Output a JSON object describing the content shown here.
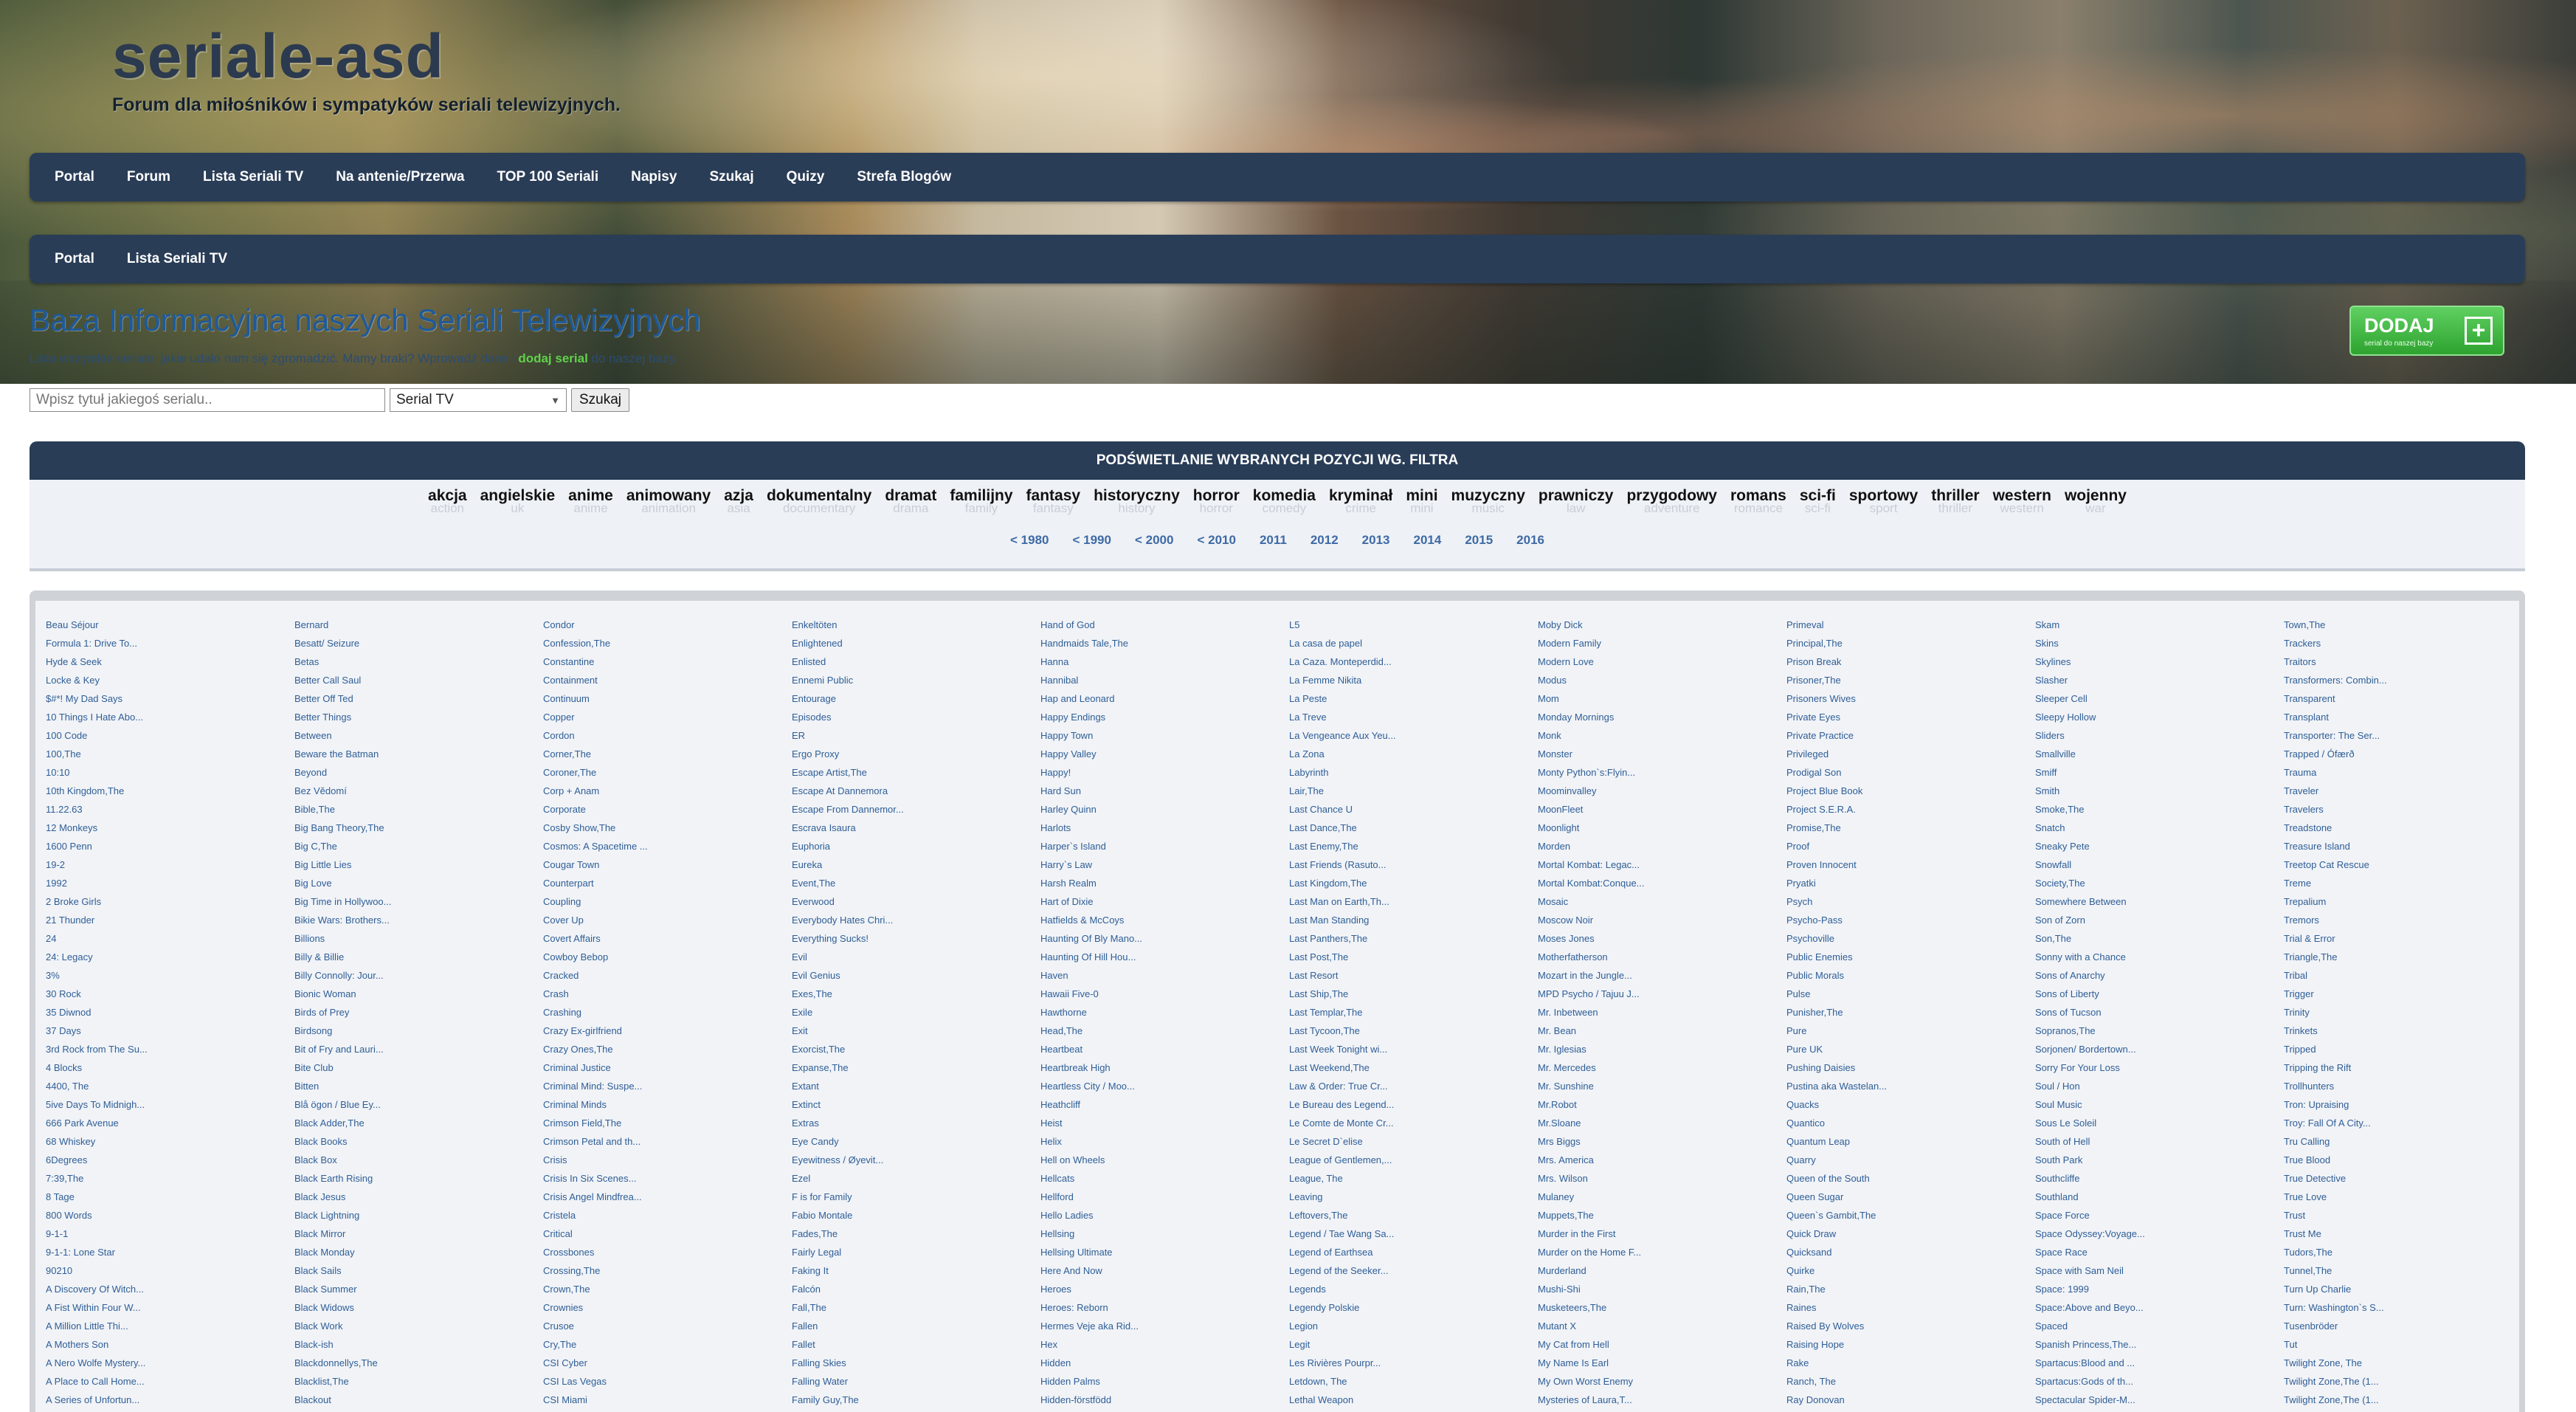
{
  "site": {
    "title": "seriale-asd",
    "subtitle": "Forum dla miłośników i sympatyków seriali telewizyjnych."
  },
  "nav_main": [
    "Portal",
    "Forum",
    "Lista Seriali TV",
    "Na antenie/Przerwa",
    "TOP 100 Seriali",
    "Napisy",
    "Szukaj",
    "Quizy",
    "Strefa Blogów"
  ],
  "nav_crumb": [
    "Portal",
    "Lista Seriali TV"
  ],
  "info": {
    "title": "Baza Informacyjna naszych Seriali Telewizyjnych",
    "text_before": "Lista wszystkie seriale, jakie udało nam się zgromadzić. Mamy braki? Wprowadź dane i ",
    "link": "dodaj serial",
    "text_after": " do naszej bazy."
  },
  "dodaj": {
    "label": "DODAJ",
    "sub": "serial do naszej bazy",
    "plus": "+"
  },
  "search": {
    "placeholder": "Wpisz tytuł jakiegoś serialu..",
    "select_value": "Serial TV",
    "button": "Szukaj"
  },
  "filter": {
    "heading": "PODŚWIETLANIE WYBRANYCH POZYCJI WG. FILTRA",
    "genres": [
      {
        "label": "akcja",
        "shadow": "action"
      },
      {
        "label": "angielskie",
        "shadow": "uk"
      },
      {
        "label": "anime",
        "shadow": "anime"
      },
      {
        "label": "animowany",
        "shadow": "animation"
      },
      {
        "label": "azja",
        "shadow": "asia"
      },
      {
        "label": "dokumentalny",
        "shadow": "documentary"
      },
      {
        "label": "dramat",
        "shadow": "drama"
      },
      {
        "label": "familijny",
        "shadow": "family"
      },
      {
        "label": "fantasy",
        "shadow": "fantasy"
      },
      {
        "label": "historyczny",
        "shadow": "history"
      },
      {
        "label": "horror",
        "shadow": "horror"
      },
      {
        "label": "komedia",
        "shadow": "comedy"
      },
      {
        "label": "kryminał",
        "shadow": "crime"
      },
      {
        "label": "mini",
        "shadow": "mini"
      },
      {
        "label": "muzyczny",
        "shadow": "music"
      },
      {
        "label": "prawniczy",
        "shadow": "law"
      },
      {
        "label": "przygodowy",
        "shadow": "adventure"
      },
      {
        "label": "romans",
        "shadow": "romance"
      },
      {
        "label": "sci-fi",
        "shadow": "sci-fi"
      },
      {
        "label": "sportowy",
        "shadow": "sport"
      },
      {
        "label": "thriller",
        "shadow": "thriller"
      },
      {
        "label": "western",
        "shadow": "western"
      },
      {
        "label": "wojenny",
        "shadow": "war"
      }
    ],
    "years": [
      "< 1980",
      "< 1990",
      "< 2000",
      "< 2010",
      "2011",
      "2012",
      "2013",
      "2014",
      "2015",
      "2016"
    ]
  },
  "columns": [
    [
      "Beau Séjour",
      "Formula 1: Drive To...",
      "Hyde & Seek",
      "Locke & Key",
      "$#*! My Dad Says",
      "10 Things I Hate Abo...",
      "100 Code",
      "100,The",
      "10:10",
      "10th Kingdom,The",
      "11.22.63",
      "12 Monkeys",
      "1600 Penn",
      "19-2",
      "1992",
      "2 Broke Girls",
      "21 Thunder",
      "24",
      "24: Legacy",
      "3%",
      "30 Rock",
      "35 Diwnod",
      "37 Days",
      "3rd Rock from The Su...",
      "4 Blocks",
      "4400, The",
      "5ive Days To Midnigh...",
      "666 Park Avenue",
      "68 Whiskey",
      "6Degrees",
      "7:39,The",
      "8 Tage",
      "800 Words",
      "9-1-1",
      "9-1-1: Lone Star",
      "90210",
      "A Discovery Of Witch...",
      "A Fist Within Four W...",
      "A Million Little Thi...",
      "A Mothers Son",
      "A Nero Wolfe Mystery...",
      "A Place to Call Home...",
      "A Series of Unfortun..."
    ],
    [
      "Bernard",
      "Besatt/ Seizure",
      "Betas",
      "Better Call Saul",
      "Better Off Ted",
      "Better Things",
      "Between",
      "Beware the Batman",
      "Beyond",
      "Bez Vědomí",
      "Bible,The",
      "Big Bang Theory,The",
      "Big C,The",
      "Big Little Lies",
      "Big Love",
      "Big Time in Hollywoo...",
      "Bikie Wars: Brothers...",
      "Billions",
      "Billy & Billie",
      "Billy Connolly: Jour...",
      "Bionic Woman",
      "Birds of Prey",
      "Birdsong",
      "Bit of Fry and Lauri...",
      "Bite Club",
      "Bitten",
      "Blå ögon / Blue Ey...",
      "Black Adder,The",
      "Black Books",
      "Black Box",
      "Black Earth Rising",
      "Black Jesus",
      "Black Lightning",
      "Black Mirror",
      "Black Monday",
      "Black Sails",
      "Black Summer",
      "Black Widows",
      "Black Work",
      "Black-ish",
      "Blackdonnellys,The",
      "Blacklist,The",
      "Blackout"
    ],
    [
      "Condor",
      "Confession,The",
      "Constantine",
      "Containment",
      "Continuum",
      "Copper",
      "Cordon",
      "Corner,The",
      "Coroner,The",
      "Corp + Anam",
      "Corporate",
      "Cosby Show,The",
      "Cosmos: A Spacetime ...",
      "Cougar Town",
      "Counterpart",
      "Coupling",
      "Cover Up",
      "Covert Affairs",
      "Cowboy Bebop",
      "Cracked",
      "Crash",
      "Crashing",
      "Crazy Ex-girlfriend",
      "Crazy Ones,The",
      "Criminal Justice",
      "Criminal Mind: Suspe...",
      "Criminal Minds",
      "Crimson Field,The",
      "Crimson Petal and th...",
      "Crisis",
      "Crisis In Six Scenes...",
      "Crisis Angel Mindfrea...",
      "Cristela",
      "Critical",
      "Crossbones",
      "Crossing,The",
      "Crown,The",
      "Crownies",
      "Crusoe",
      "Cry,The",
      "CSI Cyber",
      "CSI Las Vegas",
      "CSI Miami"
    ],
    [
      "Enkeltöten",
      "Enlightened",
      "Enlisted",
      "Ennemi Public",
      "Entourage",
      "Episodes",
      "ER",
      "Ergo Proxy",
      "Escape Artist,The",
      "Escape At Dannemora",
      "Escape From Dannemor...",
      "Escrava Isaura",
      "Euphoria",
      "Eureka",
      "Event,The",
      "Everwood",
      "Everybody Hates Chri...",
      "Everything Sucks!",
      "Evil",
      "Evil Genius",
      "Exes,The",
      "Exile",
      "Exit",
      "Exorcist,The",
      "Expanse,The",
      "Extant",
      "Extinct",
      "Extras",
      "Eye Candy",
      "Eyewitness / Øyevit...",
      "Ezel",
      "F is for Family",
      "Fabio Montale",
      "Fades,The",
      "Fairly Legal",
      "Faking It",
      "Falcón",
      "Fall,The",
      "Fallen",
      "Fallet",
      "Falling Skies",
      "Falling Water",
      "Family Guy,The"
    ],
    [
      "Hand of God",
      "Handmaids Tale,The",
      "Hanna",
      "Hannibal",
      "Hap and Leonard",
      "Happy Endings",
      "Happy Town",
      "Happy Valley",
      "Happy!",
      "Hard Sun",
      "Harley Quinn",
      "Harlots",
      "Harper`s Island",
      "Harry`s Law",
      "Harsh Realm",
      "Hart of Dixie",
      "Hatfields & McCoys",
      "Haunting Of Bly Mano...",
      "Haunting Of Hill Hou...",
      "Haven",
      "Hawaii Five-0",
      "Hawthorne",
      "Head,The",
      "Heartbeat",
      "Heartbreak High",
      "Heartless City / Moo...",
      "Heathcliff",
      "Heist",
      "Helix",
      "Hell on Wheels",
      "Hellcats",
      "Hellford",
      "Hello Ladies",
      "Hellsing",
      "Hellsing Ultimate",
      "Here And Now",
      "Heroes",
      "Heroes: Reborn",
      "Hermes Veje aka Rid...",
      "Hex",
      "Hidden",
      "Hidden Palms",
      "Hidden-förstfödd"
    ],
    [
      "L5",
      "La casa de papel",
      "La Caza. Monteperdid...",
      "La Femme Nikita",
      "La Peste",
      "La Treve",
      "La Vengeance Aux Yeu...",
      "La Zona",
      "Labyrinth",
      "Lair,The",
      "Last Chance U",
      "Last Dance,The",
      "Last Enemy,The",
      "Last Friends (Rasuto...",
      "Last Kingdom,The",
      "Last Man on Earth,Th...",
      "Last Man Standing",
      "Last Panthers,The",
      "Last Post,The",
      "Last Resort",
      "Last Ship,The",
      "Last Templar,The",
      "Last Tycoon,The",
      "Last Week Tonight wi...",
      "Last Weekend,The",
      "Law & Order: True Cr...",
      "Le Bureau des Legend...",
      "Le Comte de Monte Cr...",
      "Le Secret D`elise",
      "League of Gentlemen,...",
      "League, The",
      "Leaving",
      "Leftovers,The",
      "Legend / Tae Wang Sa...",
      "Legend of Earthsea",
      "Legend of the Seeker...",
      "Legends",
      "Legendy Polskie",
      "Legion",
      "Legit",
      "Les Rivières Pourpr...",
      "Letdown, The",
      "Lethal Weapon"
    ],
    [
      "Moby Dick",
      "Modern Family",
      "Modern Love",
      "Modus",
      "Mom",
      "Monday Mornings",
      "Monk",
      "Monster",
      "Monty Python`s:Flyin...",
      "Moominvalley",
      "MoonFleet",
      "Moonlight",
      "Morden",
      "Mortal Kombat: Legac...",
      "Mortal Kombat:Conque...",
      "Mosaic",
      "Moscow Noir",
      "Moses Jones",
      "Motherfatherson",
      "Mozart in the Jungle...",
      "MPD Psycho / Tajuu J...",
      "Mr. Inbetween",
      "Mr. Bean",
      "Mr. Iglesias",
      "Mr. Mercedes",
      "Mr. Sunshine",
      "Mr.Robot",
      "Mr.Sloane",
      "Mrs Biggs",
      "Mrs. America",
      "Mrs. Wilson",
      "Mulaney",
      "Muppets,The",
      "Murder in the First",
      "Murder on the Home F...",
      "Murderland",
      "Mushi-Shi",
      "Musketeers,The",
      "Mutant X",
      "My Cat from Hell",
      "My Name Is Earl",
      "My Own Worst Enemy",
      "Mysteries of Laura,T..."
    ],
    [
      "Primeval",
      "Principal,The",
      "Prison Break",
      "Prisoner,The",
      "Prisoners Wives",
      "Private Eyes",
      "Private Practice",
      "Privileged",
      "Prodigal Son",
      "Project Blue Book",
      "Project S.E.R.A.",
      "Promise,The",
      "Proof",
      "Proven Innocent",
      "Pryatki",
      "Psych",
      "Psycho-Pass",
      "Psychoville",
      "Public Enemies",
      "Public Morals",
      "Pulse",
      "Punisher,The",
      "Pure",
      "Pure UK",
      "Pushing Daisies",
      "Pustina aka Wastelan...",
      "Quacks",
      "Quantico",
      "Quantum Leap",
      "Quarry",
      "Queen of the South",
      "Queen Sugar",
      "Queen`s Gambit,The",
      "Quick Draw",
      "Quicksand",
      "Quirke",
      "Rain,The",
      "Raines",
      "Raised By Wolves",
      "Raising Hope",
      "Rake",
      "Ranch, The",
      "Ray Donovan"
    ],
    [
      "Skam",
      "Skins",
      "Skylines",
      "Slasher",
      "Sleeper Cell",
      "Sleepy Hollow",
      "Sliders",
      "Smallville",
      "Smiff",
      "Smith",
      "Smoke,The",
      "Snatch",
      "Sneaky Pete",
      "Snowfall",
      "Society,The",
      "Somewhere Between",
      "Son of Zorn",
      "Son,The",
      "Sonny with a Chance",
      "Sons of Anarchy",
      "Sons of Liberty",
      "Sons of Tucson",
      "Sopranos,The",
      "Sorjonen/ Bordertown...",
      "Sorry For Your Loss",
      "Soul / Hon",
      "Soul Music",
      "Sous Le Soleil",
      "South of Hell",
      "South Park",
      "Southcliffe",
      "Southland",
      "Space Force",
      "Space Odyssey:Voyage...",
      "Space Race",
      "Space with Sam Neil",
      "Space: 1999",
      "Space:Above and Beyo...",
      "Spaced",
      "Spanish Princess,The...",
      "Spartacus:Blood and ...",
      "Spartacus:Gods of th...",
      "Spectacular Spider-M..."
    ],
    [
      "Town,The",
      "Trackers",
      "Traitors",
      "Transformers: Combin...",
      "Transparent",
      "Transplant",
      "Transporter: The Ser...",
      "Trapped / Ófærð",
      "Trauma",
      "Traveler",
      "Travelers",
      "Treadstone",
      "Treasure Island",
      "Treetop Cat Rescue",
      "Treme",
      "Trepalium",
      "Tremors",
      "Trial & Error",
      "Triangle,The",
      "Tribal",
      "Trigger",
      "Trinity",
      "Trinkets",
      "Tripped",
      "Tripping the Rift",
      "Trollhunters",
      "Tron: Upraising",
      "Troy: Fall Of A City...",
      "Tru Calling",
      "True Blood",
      "True Detective",
      "True Love",
      "Trust",
      "Trust Me",
      "Tudors,The",
      "Tunnel,The",
      "Turn Up Charlie",
      "Turn: Washington`s S...",
      "Tusenbröder",
      "Tut",
      "Twilight Zone, The",
      "Twilight Zone,The (1...",
      "Twilight Zone,The (1..."
    ]
  ]
}
